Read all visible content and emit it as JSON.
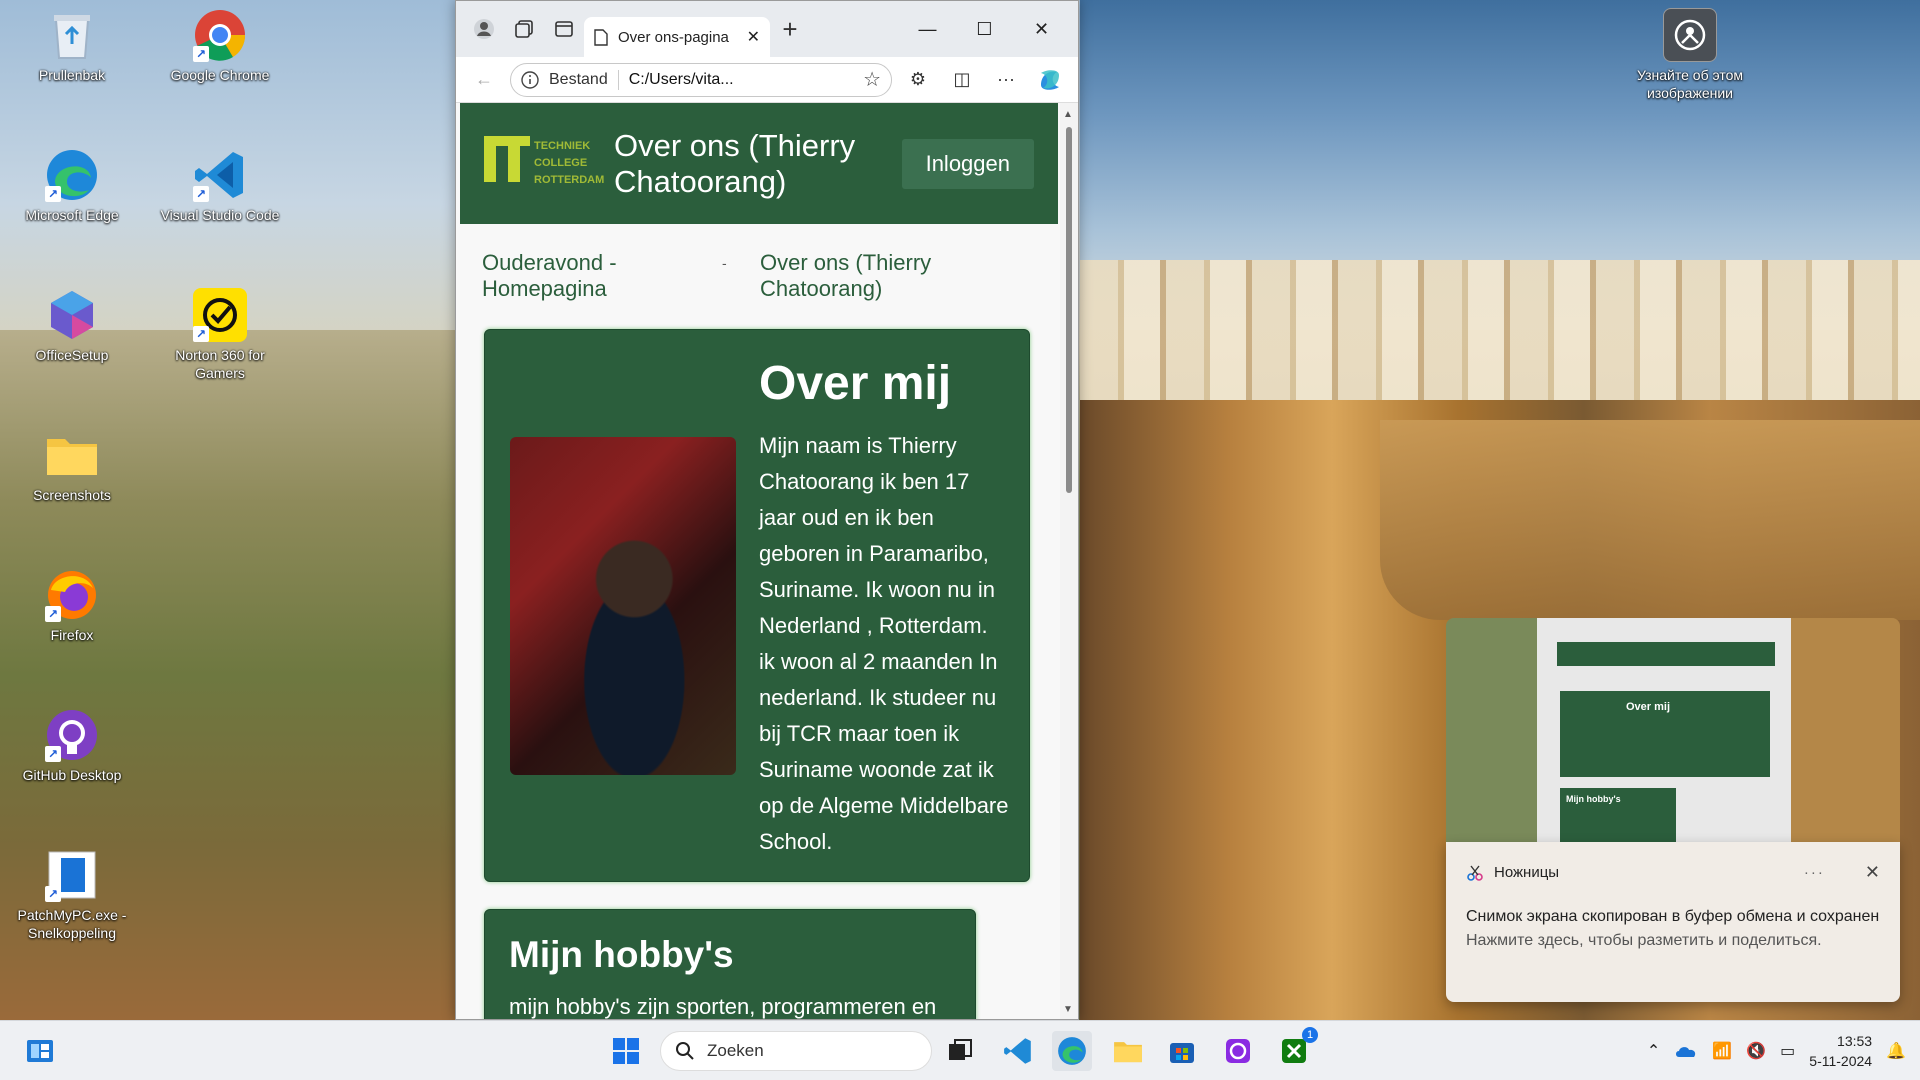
{
  "desktop": {
    "icons": [
      {
        "label": "Prullenbak"
      },
      {
        "label": "Google Chrome"
      },
      {
        "label": "Microsoft Edge"
      },
      {
        "label": "Visual Studio Code"
      },
      {
        "label": "OfficeSetup"
      },
      {
        "label": "Norton 360 for Gamers"
      },
      {
        "label": "Screenshots"
      },
      {
        "label": "Firefox"
      },
      {
        "label": "GitHub Desktop"
      },
      {
        "label": "PatchMyPC.exe - Snelkoppeling"
      },
      {
        "label": "Узнайте об этом изображении"
      }
    ]
  },
  "browser": {
    "tab_title": "Over ons-pagina",
    "address_scheme": "Bestand",
    "address_url": "C:/Users/vita...",
    "page": {
      "logo_text": [
        "TECHNIEK",
        "COLLEGE",
        "ROTTERDAM"
      ],
      "site_title": "Over ons (Thierry Chatoorang)",
      "login_label": "Inloggen",
      "breadcrumb": {
        "home": "Ouderavond - Homepagina",
        "separator": "-",
        "current": "Over ons (Thierry Chatoorang)"
      },
      "about": {
        "heading": "Over mij",
        "text": "Mijn naam is Thierry Chatoorang ik ben 17 jaar oud en ik ben geboren in Paramaribo, Suriname. Ik woon nu in Nederland , Rotterdam. ik woon al 2 maanden In nederland. Ik studeer nu bij TCR maar toen ik Suriname woonde zat ik op de Algeme Middelbare School."
      },
      "hobbies": {
        "heading": "Mijn hobby's",
        "text": "mijn hobby's zijn sporten, programmeren en"
      }
    }
  },
  "notification": {
    "app": "Ножницы",
    "more": "···",
    "message": "Снимок экрана скопирован в буфер обмена и сохранен",
    "sub": "Нажмите здесь, чтобы разметить и поделиться.",
    "preview_title": "Over mij",
    "preview_hobbies": "Mijn hobby's"
  },
  "taskbar": {
    "search_placeholder": "Zoeken",
    "time": "13:53",
    "date": "5-11-2024",
    "badge": "1"
  },
  "colors": {
    "site_green": "#2b5e3c",
    "logo_lime": "#c8d934"
  }
}
